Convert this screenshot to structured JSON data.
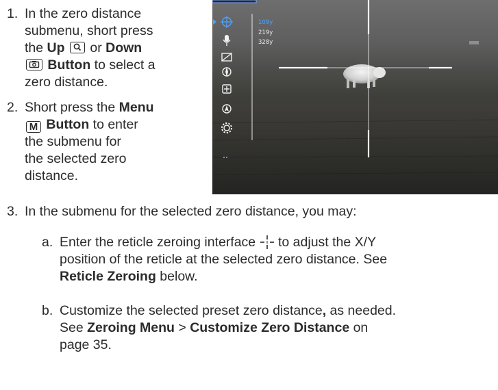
{
  "steps": [
    {
      "number": "1.",
      "lines": [
        [
          "In the zero distance"
        ],
        [
          "submenu, short press"
        ],
        [
          "the ",
          {
            "b": "Up"
          },
          " ",
          {
            "key": "zoom-icon"
          },
          " or ",
          {
            "b": "Down"
          }
        ],
        [
          {
            "key": "camera-icon"
          },
          " ",
          {
            "b": "Button"
          },
          " to select a"
        ],
        [
          "zero distance."
        ]
      ]
    },
    {
      "number": "2.",
      "lines": [
        [
          "Short press the ",
          {
            "b": "Menu"
          }
        ],
        [
          {
            "keytext": "M"
          },
          " ",
          {
            "b": "Button"
          },
          " to enter"
        ],
        [
          "the submenu for"
        ],
        [
          "the selected zero"
        ],
        [
          "distance."
        ]
      ]
    },
    {
      "number": "3.",
      "lines": [
        [
          "In the submenu for the selected zero distance, you may:"
        ]
      ]
    }
  ],
  "substeps": [
    {
      "letter": "a.",
      "lines": [
        [
          "Enter the reticle zeroing interface ",
          {
            "icon": "zeroing-reticle-icon"
          },
          " to adjust the X/Y"
        ],
        [
          "position of the reticle at the selected zero distance. See"
        ],
        [
          {
            "b": "Reticle Zeroing"
          },
          " below."
        ]
      ]
    },
    {
      "letter": "b.",
      "lines": [
        [
          "Customize the selected preset zero distance",
          {
            "b": ","
          },
          " as needed."
        ],
        [
          "See ",
          {
            "b": "Zeroing Menu"
          },
          " > ",
          {
            "b": "Customize Zero Distance"
          },
          " on"
        ],
        [
          "page 35."
        ]
      ]
    }
  ],
  "screen": {
    "distances": [
      "109y",
      "219y",
      "328y"
    ],
    "selected_distance_color": "#4da3ff",
    "menu_icons": [
      "crosshair-target-icon",
      "microphone-icon",
      "picture-in-picture-icon",
      "compass-icon",
      "plus-box-icon",
      "navigation-icon",
      "gear-icon"
    ]
  }
}
